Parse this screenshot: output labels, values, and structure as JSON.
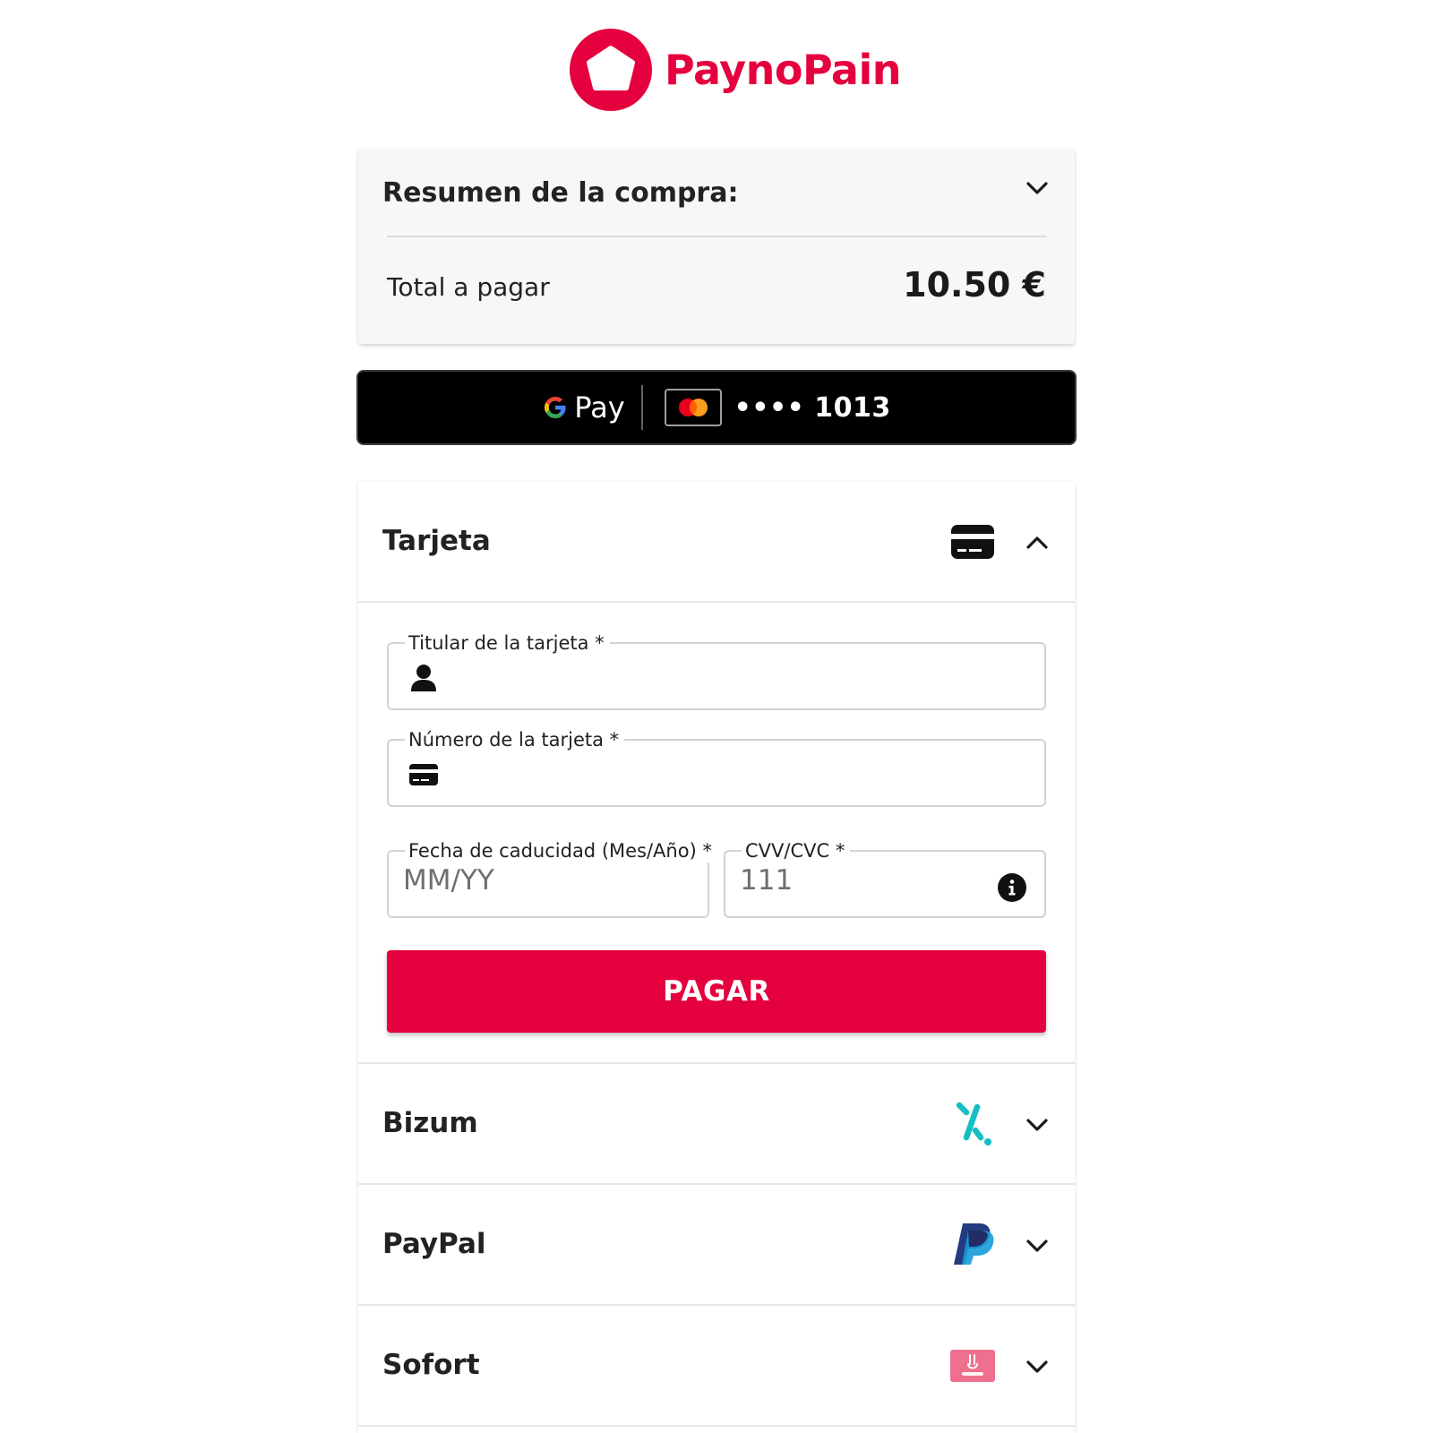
{
  "brand": {
    "name": "PaynoPain",
    "color": "#e5003e",
    "logo_icon": "pentagon-logo-icon"
  },
  "summary": {
    "title": "Resumen de la compra:",
    "total_label": "Total a pagar",
    "total_amount": "10.50 €"
  },
  "google_pay": {
    "pay_label": "Pay",
    "card_masked": "•••• 1013",
    "card_brand_icon": "mastercard-icon"
  },
  "methods": [
    {
      "title": "Tarjeta",
      "icon": "credit-card-icon",
      "expanded": true
    },
    {
      "title": "Bizum",
      "icon": "bizum-icon",
      "expanded": false
    },
    {
      "title": "PayPal",
      "icon": "paypal-icon",
      "expanded": false
    },
    {
      "title": "Sofort",
      "icon": "sofort-icon",
      "expanded": false
    }
  ],
  "card_form": {
    "holder_label": "Titular de la tarjeta *",
    "holder_value": "",
    "number_label": "Número de la tarjeta *",
    "number_value": "",
    "expiry_label": "Fecha de caducidad (Mes/Año) *",
    "expiry_placeholder": "MM/YY",
    "cvv_label": "CVV/CVC *",
    "cvv_placeholder": "111",
    "pay_button": "PAGAR"
  }
}
